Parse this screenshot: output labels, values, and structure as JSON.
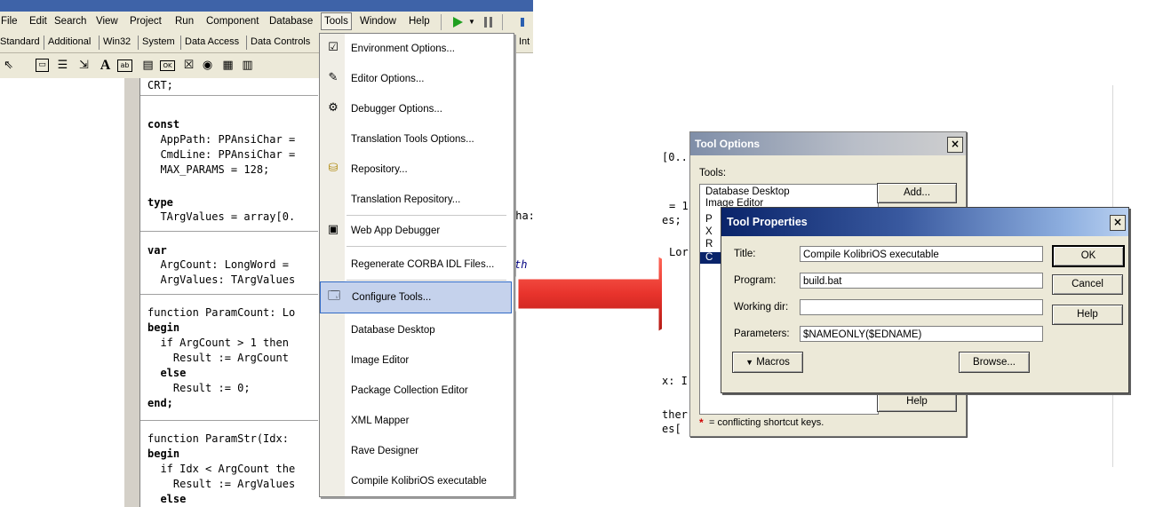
{
  "ide": {
    "menu": [
      "File",
      "Edit",
      "Search",
      "View",
      "Project",
      "Run",
      "Component",
      "Database",
      "Tools",
      "Window",
      "Help"
    ],
    "palette_tabs": [
      "Standard",
      "Additional",
      "Win32",
      "System",
      "Data Access",
      "Data Controls"
    ],
    "palette_tab_extra": "Int",
    "code_lines": [
      "CRT;",
      "",
      "const",
      "  AppPath: PPAnsiChar =",
      "  CmdLine: PPAnsiChar =",
      "  MAX_PARAMS = 128;",
      "",
      "type",
      "  TArgValues = array[0.",
      "",
      "var",
      "  ArgCount: LongWord =",
      "  ArgValues: TArgValues",
      "",
      "function ParamCount: Lo",
      "begin",
      "  if ArgCount > 1 then",
      "    Result := ArgCount",
      "  else",
      "    Result := 0;",
      "end;",
      "",
      "function ParamStr(Idx:",
      "begin",
      "  if Idx < ArgCount the",
      "    Result := ArgValues",
      "  else"
    ],
    "peek_right": [
      "Cha:",
      "th"
    ]
  },
  "tools_menu": {
    "items": [
      {
        "label": "Environment Options...",
        "icon": "environment-options-icon"
      },
      {
        "label": "Editor Options...",
        "icon": "editor-options-icon"
      },
      {
        "label": "Debugger Options...",
        "icon": "debugger-options-icon"
      },
      {
        "label": "Translation Tools Options...",
        "icon": ""
      },
      {
        "label": "Repository...",
        "icon": "repository-icon"
      },
      {
        "label": "Translation Repository...",
        "icon": ""
      },
      {
        "label": "Web App Debugger",
        "icon": "web-app-debugger-icon"
      },
      {
        "label": "Regenerate CORBA IDL Files...",
        "icon": ""
      },
      {
        "label": "Configure Tools...",
        "icon": "configure-tools-icon"
      },
      {
        "label": "Database Desktop",
        "icon": ""
      },
      {
        "label": "Image Editor",
        "icon": ""
      },
      {
        "label": "Package Collection Editor",
        "icon": ""
      },
      {
        "label": "XML Mapper",
        "icon": ""
      },
      {
        "label": "Rave Designer",
        "icon": ""
      },
      {
        "label": "Compile KolibriOS executable",
        "icon": ""
      }
    ],
    "highlighted_index": 8
  },
  "right_peek": [
    "[0..",
    "= 1",
    "es;",
    "Lor",
    "x: I",
    "ther",
    "es["
  ],
  "tool_options": {
    "title": "Tool Options",
    "tools_label": "Tools:",
    "list": [
      "Database Desktop",
      "Image Editor",
      "P",
      "X",
      "R",
      "C"
    ],
    "add_button": "Add...",
    "help_button": "Help",
    "footer_star": "*",
    "footer_text": "= conflicting shortcut keys."
  },
  "tool_properties": {
    "title": "Tool Properties",
    "title_label": "Title:",
    "title_value": "Compile KolibriOS executable",
    "program_label": "Program:",
    "program_value": "build.bat",
    "workdir_label": "Working dir:",
    "workdir_value": "",
    "params_label": "Parameters:",
    "params_value": "$NAMEONLY($EDNAME)",
    "ok_button": "OK",
    "cancel_button": "Cancel",
    "help_button": "Help",
    "macros_button": "Macros",
    "browse_button": "Browse..."
  },
  "colors": {
    "highlight": "#c5d2ec",
    "arrow_red": "#e8332c",
    "titlebar_blue": "#0a246a"
  }
}
